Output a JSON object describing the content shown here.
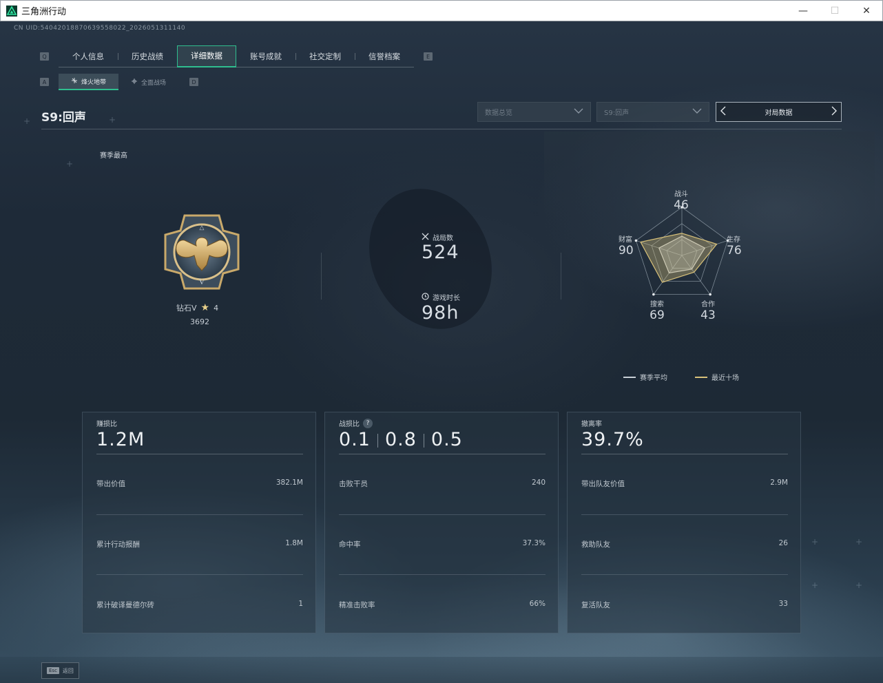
{
  "window": {
    "title": "三角洲行动",
    "min": "—",
    "max": "☐",
    "close": "✕"
  },
  "uid": "CN UID:54042018870639558022_2026051311140",
  "main_tabs": {
    "key_left": "Q",
    "key_right": "E",
    "items": [
      {
        "label": "个人信息"
      },
      {
        "label": "历史战绩"
      },
      {
        "label": "详细数据",
        "active": true
      },
      {
        "label": "账号成就"
      },
      {
        "label": "社交定制"
      },
      {
        "label": "信誉档案"
      }
    ]
  },
  "sub_tabs": {
    "key_left": "A",
    "key_right": "D",
    "items": [
      {
        "label": "烽火地带",
        "icon": "extraction-icon",
        "active": true
      },
      {
        "label": "全面战场",
        "icon": "battlefield-icon"
      }
    ]
  },
  "season": {
    "title": "S9:回声",
    "dropdown_mode": "数据总览",
    "dropdown_season": "S9:回声",
    "nav_label": "对局数据"
  },
  "summary": {
    "section_label": "赛季最高",
    "rank_name": "钻石V",
    "rank_stars": "4",
    "rank_score": "3692",
    "matches_label": "战局数",
    "matches_value": "524",
    "playtime_label": "游戏时长",
    "playtime_value": "98h"
  },
  "radar": {
    "axes": [
      {
        "label": "战斗",
        "value": "46"
      },
      {
        "label": "生存",
        "value": "76"
      },
      {
        "label": "合作",
        "value": "43"
      },
      {
        "label": "搜索",
        "value": "69"
      },
      {
        "label": "财富",
        "value": "90"
      }
    ],
    "season_avg": [
      0.4,
      0.5,
      0.35,
      0.45,
      0.5
    ],
    "recent_ten": [
      0.46,
      0.76,
      0.43,
      0.69,
      0.9
    ],
    "legend_avg": "赛季平均",
    "legend_recent": "最近十场",
    "color_avg": "#c9d0d6",
    "color_recent": "#d9c27a"
  },
  "cards": [
    {
      "title": "赚损比",
      "big": "1.2M",
      "rows": [
        {
          "label": "带出价值",
          "value": "382.1M"
        },
        {
          "label": "累计行动报酬",
          "value": "1.8M"
        },
        {
          "label": "累计破译曼德尔砖",
          "value": "1"
        }
      ]
    },
    {
      "title": "战损比",
      "big_parts": [
        "0.1",
        "0.8",
        "0.5"
      ],
      "rows": [
        {
          "label": "击败干员",
          "value": "240"
        },
        {
          "label": "命中率",
          "value": "37.3%"
        },
        {
          "label": "精准击败率",
          "value": "66%"
        }
      ]
    },
    {
      "title": "撤离率",
      "big": "39.7%",
      "rows": [
        {
          "label": "带出队友价值",
          "value": "2.9M"
        },
        {
          "label": "救助队友",
          "value": "26"
        },
        {
          "label": "复活队友",
          "value": "33"
        }
      ]
    }
  ],
  "footer": {
    "esc_key": "Esc",
    "back_label": "返回"
  }
}
